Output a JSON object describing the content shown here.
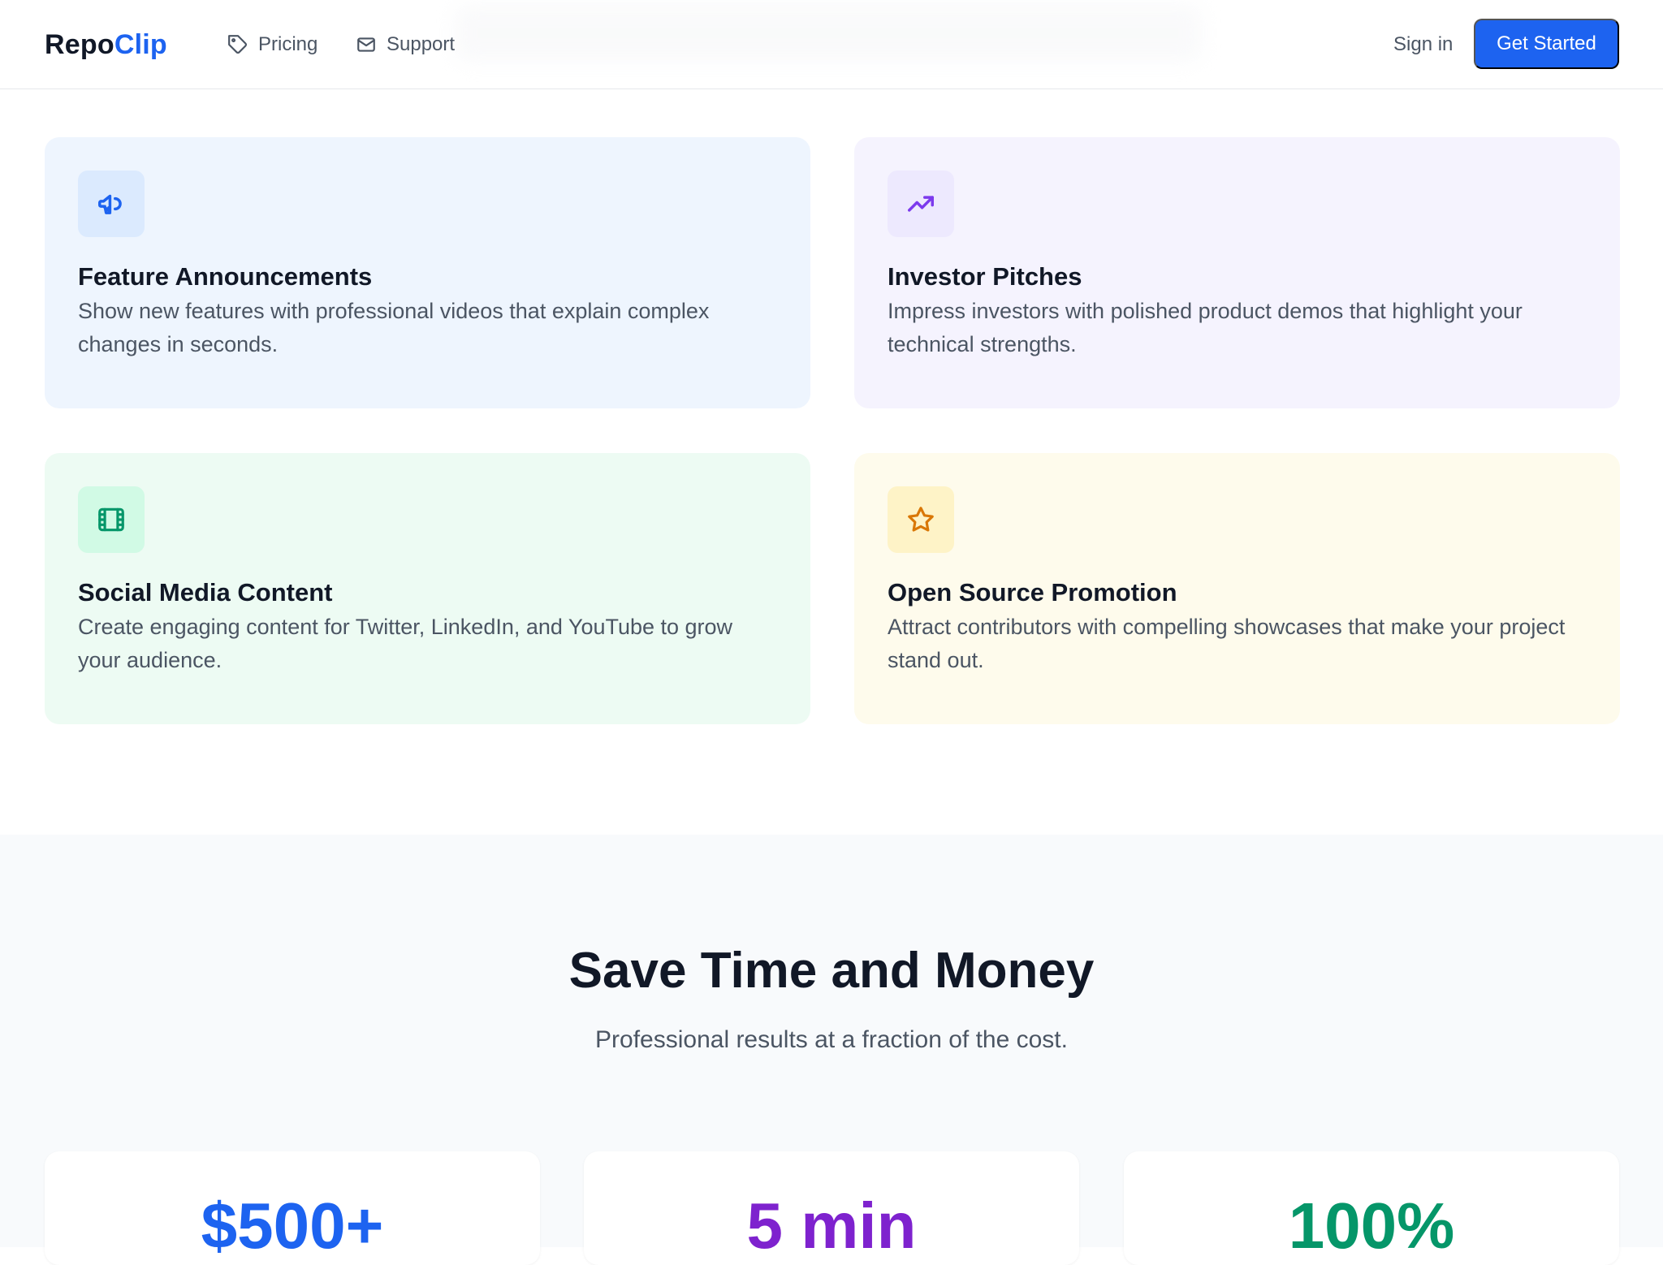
{
  "header": {
    "logo_part1": "Repo",
    "logo_part2": "Clip",
    "nav": [
      {
        "label": "Pricing",
        "icon": "tag-icon"
      },
      {
        "label": "Support",
        "icon": "mail-icon"
      }
    ],
    "sign_in": "Sign in",
    "cta": "Get Started"
  },
  "cards": [
    {
      "title": "Feature Announcements",
      "desc": "Show new features with professional videos that explain complex changes in seconds.",
      "icon": "megaphone-icon",
      "bg": "#eef5fe",
      "icon_bg": "#dbeafe",
      "icon_color": "#1d63f0"
    },
    {
      "title": "Investor Pitches",
      "desc": "Impress investors with polished product demos that highlight your technical strengths.",
      "icon": "trending-up-icon",
      "bg": "#f5f3fe",
      "icon_bg": "#ede9fe",
      "icon_color": "#7c3aed"
    },
    {
      "title": "Social Media Content",
      "desc": "Create engaging content for Twitter, LinkedIn, and YouTube to grow your audience.",
      "icon": "film-icon",
      "bg": "#edfbf3",
      "icon_bg": "#d1fae5",
      "icon_color": "#059669"
    },
    {
      "title": "Open Source Promotion",
      "desc": "Attract contributors with compelling showcases that make your project stand out.",
      "icon": "star-icon",
      "bg": "#fefbec",
      "icon_bg": "#fef3c7",
      "icon_color": "#d97706"
    }
  ],
  "section": {
    "title": "Save Time and Money",
    "subtitle": "Professional results at a fraction of the cost."
  },
  "stats": [
    {
      "value": "$500+",
      "color": "#1d63f0"
    },
    {
      "value": "5 min",
      "color": "#7e22ce"
    },
    {
      "value": "100%",
      "color": "#059669"
    }
  ]
}
